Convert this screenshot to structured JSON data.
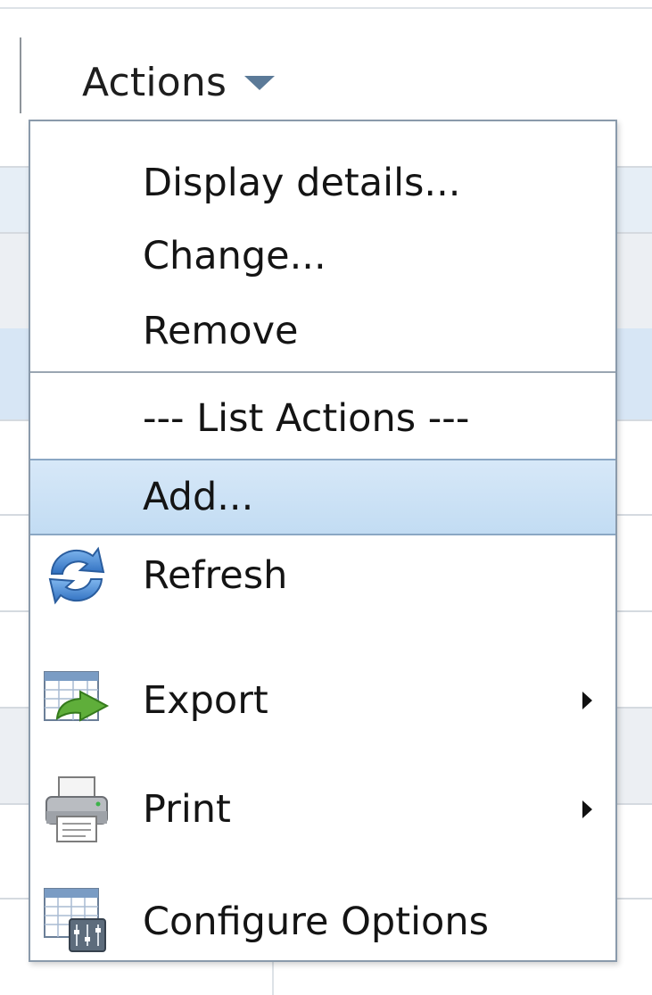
{
  "toolbar": {
    "actions_label": "Actions"
  },
  "menu": {
    "items": [
      {
        "label": "Display details..."
      },
      {
        "label": "Change..."
      },
      {
        "label": "Remove"
      },
      {
        "label": "--- List Actions ---"
      },
      {
        "label": "Add..."
      },
      {
        "label": "Refresh",
        "icon": "refresh-icon"
      },
      {
        "label": "Export",
        "icon": "export-icon",
        "submenu": true
      },
      {
        "label": "Print",
        "icon": "printer-icon",
        "submenu": true
      },
      {
        "label": "Configure Options",
        "icon": "configure-options-icon"
      }
    ]
  },
  "colors": {
    "highlight": "#c9e0f5",
    "menu_border": "#8a9aab",
    "caret": "#5b7a98"
  }
}
